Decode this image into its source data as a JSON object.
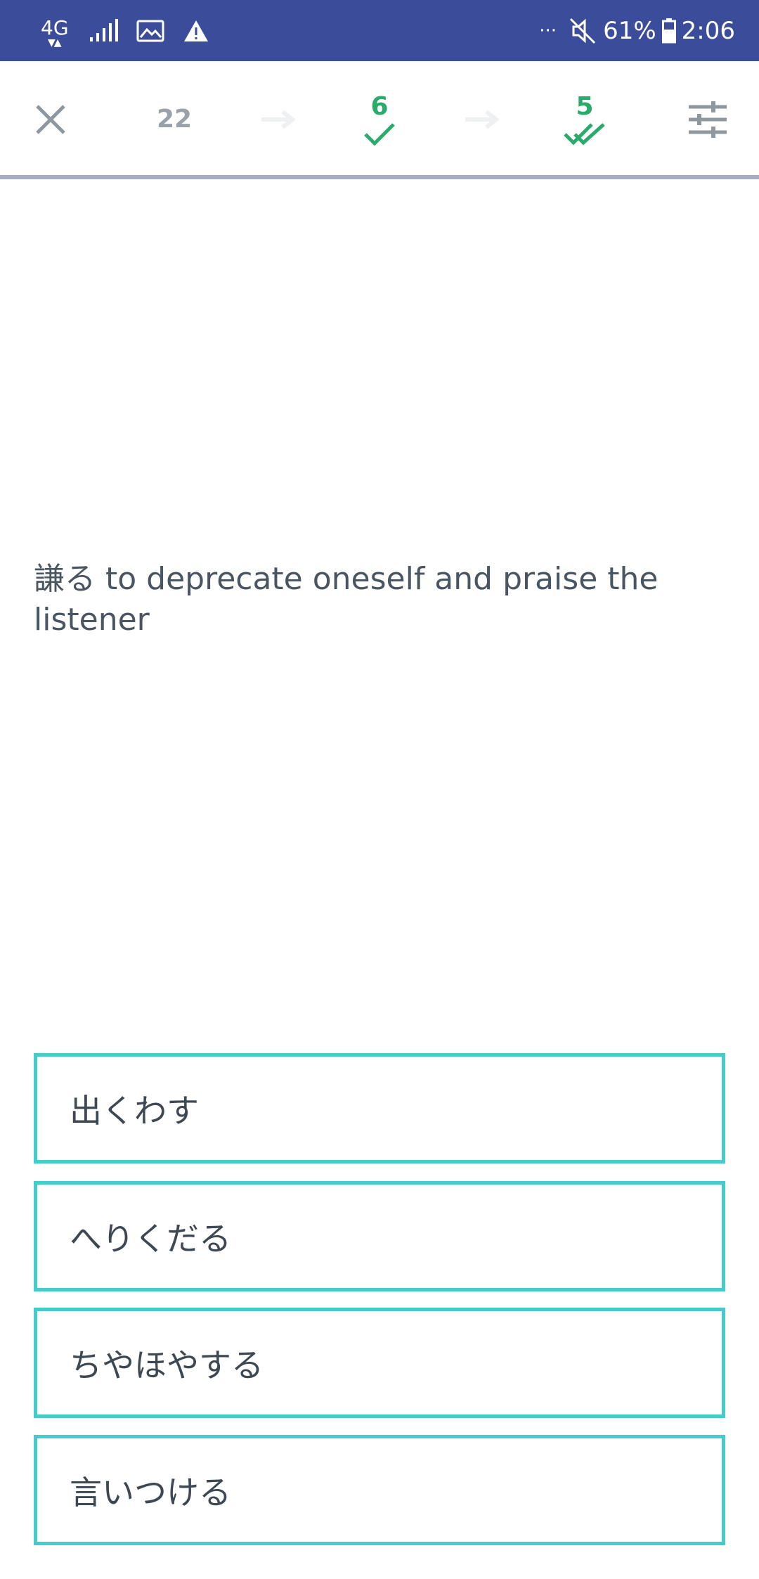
{
  "status_bar": {
    "network": "4G",
    "battery": "61%",
    "time": "2:06",
    "more": "···"
  },
  "toolbar": {
    "close_icon": "close-icon",
    "settings_icon": "sliders-icon",
    "new_count": "22",
    "learned_count": "6",
    "mastered_count": "5"
  },
  "question": {
    "prompt": "謙る to deprecate oneself and praise the listener"
  },
  "options": [
    {
      "label": "出くわす"
    },
    {
      "label": "へりくだる"
    },
    {
      "label": "ちやほやする"
    },
    {
      "label": "言いつける"
    }
  ],
  "colors": {
    "status_bar": "#3b4d9a",
    "accent_green": "#2aaa6b",
    "option_border": "#45cbcb",
    "progress_line": "#a7adc7"
  }
}
